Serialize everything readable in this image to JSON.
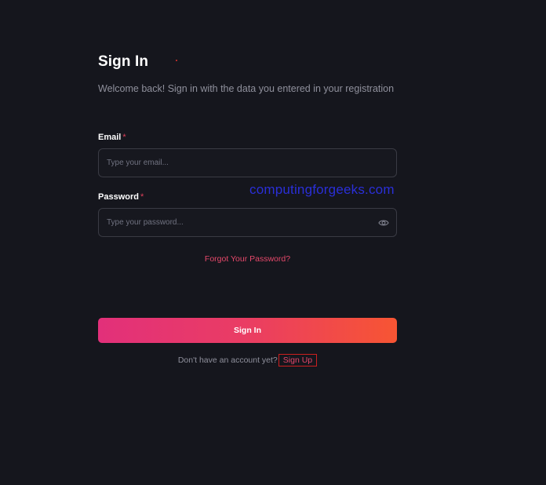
{
  "header": {
    "title": "Sign In",
    "subtitle": "Welcome back! Sign in with the data you entered in your registration"
  },
  "form": {
    "email": {
      "label": "Email",
      "required_mark": "*",
      "value": "",
      "placeholder": "Type your email..."
    },
    "password": {
      "label": "Password",
      "required_mark": "*",
      "value": "",
      "placeholder": "Type your password...",
      "toggle_icon": "eye-icon"
    },
    "forgot_password": "Forgot Your Password?",
    "submit_label": "Sign In"
  },
  "footer": {
    "prompt": "Don't have an account yet?",
    "signup_label": "Sign Up"
  },
  "watermark": "computingforgeeks.com",
  "colors": {
    "background": "#15161d",
    "accent": "#e5486a",
    "gradient_start": "#e2307a",
    "gradient_end": "#f75533",
    "required": "#e0405a",
    "highlight_box": "#cc1f1f",
    "watermark": "#2a2fd8"
  }
}
